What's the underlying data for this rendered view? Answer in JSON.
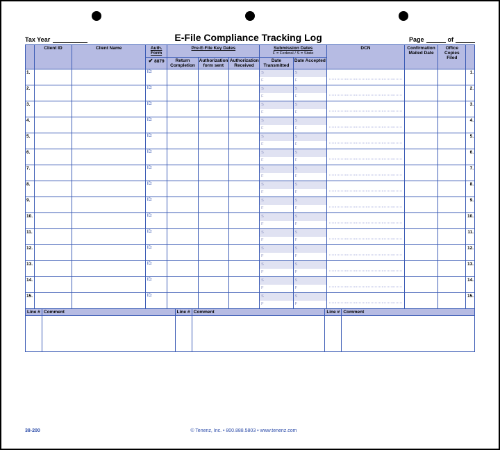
{
  "top": {
    "tax_year_label": "Tax Year",
    "title": "E-File Compliance Tracking Log",
    "page_label": "Page",
    "page_of": "of"
  },
  "cols": {
    "client_id": "Client ID",
    "client_name": "Client Name",
    "auth_form": "Auth. Form",
    "auth_8879": "8879",
    "pre_efile": "Pre-E-File Key Dates",
    "return_completion": "Return Completion",
    "auth_form_sent": "Authorization form sent",
    "auth_received": "Authorization Received",
    "submission": "Submission Dates",
    "submission_note": "F = Federal  /  S = State",
    "date_transmitted": "Date Transmitted",
    "date_accepted": "Date Accepted",
    "dcn": "DCN",
    "confirmation": "Confirmation Mailed Date",
    "copies": "Office Copies Filed"
  },
  "id_label": "ID:",
  "sub_f": "S",
  "sub_s": "F",
  "rows": [
    "1.",
    "2.",
    "3.",
    "4.",
    "5.",
    "6.",
    "7.",
    "8.",
    "9.",
    "10.",
    "11.",
    "12.",
    "13.",
    "14.",
    "15."
  ],
  "comments": {
    "line": "Line #",
    "comment": "Comment"
  },
  "footer": {
    "code": "38-200",
    "copy": "© Tenenz, Inc. • 800.888.5803 • www.tenenz.com"
  },
  "check": "✔"
}
